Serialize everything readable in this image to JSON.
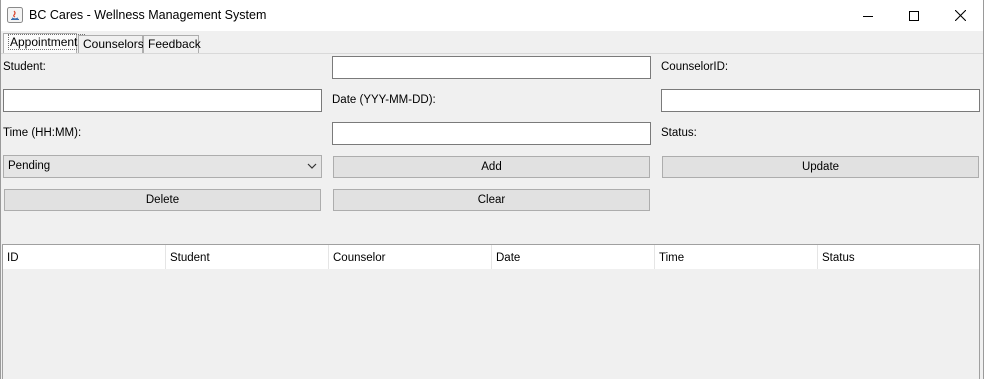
{
  "window": {
    "title": "BC Cares - Wellness Management System"
  },
  "tabs": [
    {
      "label": "Appointments",
      "active": true
    },
    {
      "label": "Counselors",
      "active": false
    },
    {
      "label": "Feedback",
      "active": false
    }
  ],
  "form": {
    "student_label": "Student:",
    "student_value": "",
    "counselor_label": "CounselorID:",
    "counselor_value": "",
    "date_label": "Date (YYY-MM-DD):",
    "date_value": "",
    "time_label": "Time (HH:MM):",
    "time_value": "",
    "status_label": "Status:",
    "status_selected": "Pending"
  },
  "buttons": {
    "add": "Add",
    "update": "Update",
    "delete": "Delete",
    "clear": "Clear"
  },
  "table": {
    "columns": [
      "ID",
      "Student",
      "Counselor",
      "Date",
      "Time",
      "Status"
    ],
    "rows": []
  },
  "colors": {
    "window_bg": "#f0f0f0",
    "button_bg": "#e1e1e1",
    "border": "#adadad"
  }
}
